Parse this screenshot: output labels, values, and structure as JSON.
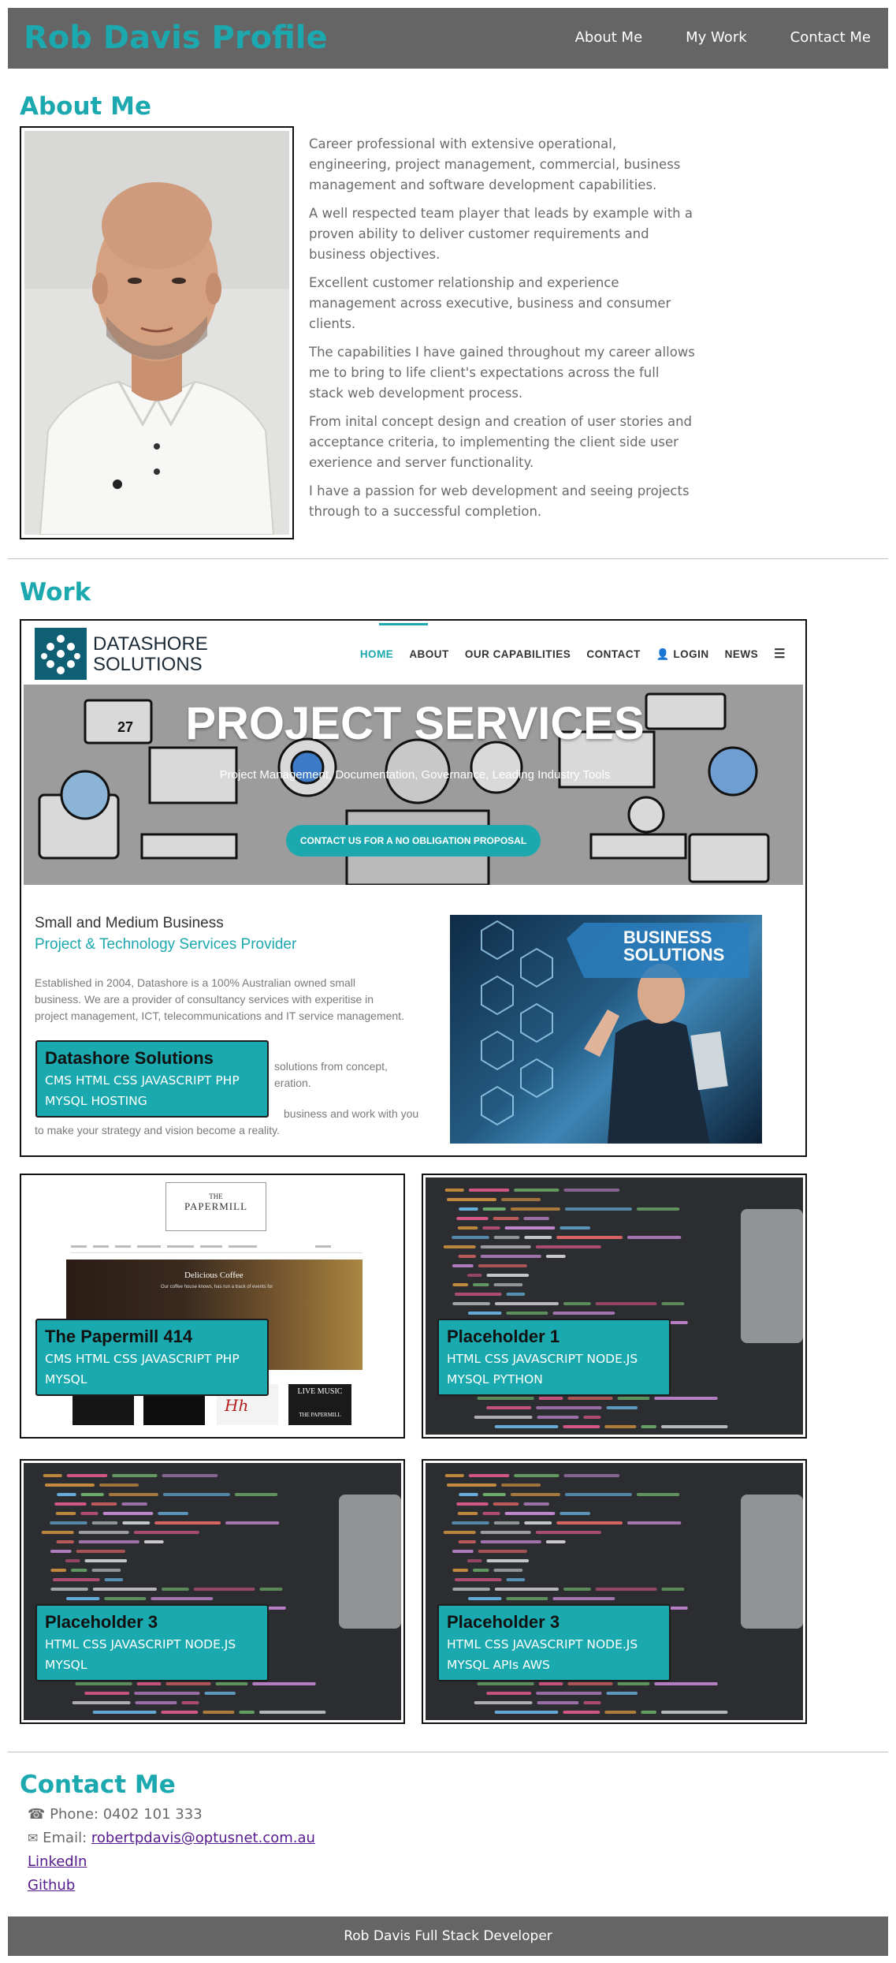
{
  "header": {
    "title": "Rob Davis Profile",
    "nav": [
      "About Me",
      "My Work",
      "Contact Me"
    ]
  },
  "about": {
    "heading": "About Me",
    "paragraphs": [
      "Career professional with extensive operational, engineering, project management, commercial, business management and software development capabilities.",
      "A well respected team player that leads by example with a proven ability to deliver customer requirements and business objectives.",
      "Excellent customer relationship and experience management across executive, business and consumer clients.",
      "The capabilities I have gained throughout my career allows me to bring to life client's expectations across the full stack web development process.",
      "From inital concept design and creation of user stories and acceptance criteria, to implementing the client side user exerience and server functionality.",
      "I have a passion for web development and seeing projects through to a successful completion."
    ]
  },
  "work": {
    "heading": "Work",
    "featured": {
      "site": {
        "logo_line1": "DATASHORE",
        "logo_line2": "SOLUTIONS",
        "nav": [
          "HOME",
          "ABOUT",
          "OUR CAPABILITIES",
          "CONTACT",
          "LOGIN",
          "NEWS"
        ],
        "hero_title": "PROJECT SERVICES",
        "hero_sub": "Project Management, Documentation, Governance, Leading Industry Tools",
        "hero_cta": "CONTACT US FOR A NO OBLIGATION PROPOSAL",
        "calendar_day": "27",
        "sub_heading": "Small and Medium Business",
        "sub_heading2": "Project & Technology Services Provider",
        "body1": "Established in 2004, Datashore is a 100% Australian owned small business. We are a provider of consultancy services with experitise in project management, ICT, telecommunications and IT service management.",
        "body2": "solutions from concept,",
        "body3": "eration.",
        "body4": "to make your strategy and vision become a reality.",
        "body4a": "business and work with you",
        "badge_line1": "BUSINESS",
        "badge_line2": "SOLUTIONS"
      },
      "caption": {
        "title": "Datashore Solutions",
        "tags": "CMS HTML CSS JAVASCRIPT PHP MYSQL HOSTING"
      }
    },
    "papermill": {
      "site": {
        "logo_top": "THE",
        "logo_name": "PAPERMILL",
        "hero_text": "Delicious Coffee",
        "hero_sub": "Our coffee house knows, has run a track of events for",
        "thumb_label": "LIVE MUSIC",
        "thumb_brand": "THE PAPERMILL"
      },
      "caption": {
        "title": "The Papermill 414",
        "tags": "CMS HTML CSS JAVASCRIPT PHP MYSQL"
      }
    },
    "placeholders": [
      {
        "title": "Placeholder 1",
        "tags": "HTML CSS JAVASCRIPT NODE.JS MYSQL PYTHON"
      },
      {
        "title": "Placeholder 3",
        "tags": "HTML CSS JAVASCRIPT NODE.JS MYSQL"
      },
      {
        "title": "Placeholder 3",
        "tags": "HTML CSS JAVASCRIPT NODE.JS MYSQL APIs AWS"
      }
    ]
  },
  "contact": {
    "heading": "Contact Me",
    "phone_label": "Phone: 0402 101 333",
    "email_label": "Email:",
    "email": "robertpdavis@optusnet.com.au",
    "linkedin": "LinkedIn",
    "github": "Github"
  },
  "footer": {
    "text": "Rob Davis Full Stack Developer"
  },
  "colors": {
    "accent": "#1ba8ae",
    "header_bg": "#656565",
    "link": "#551a8b"
  }
}
